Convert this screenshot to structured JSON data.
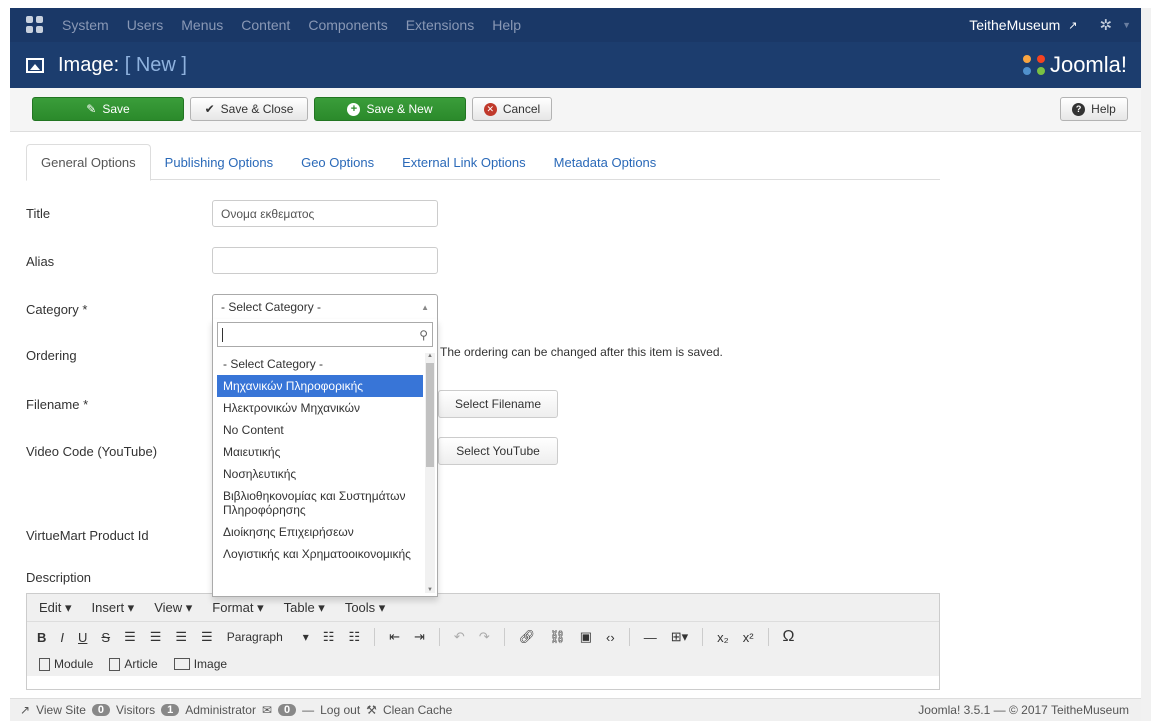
{
  "nav": {
    "menu": [
      "System",
      "Users",
      "Menus",
      "Content",
      "Components",
      "Extensions",
      "Help"
    ],
    "site_name": "TeitheMuseum"
  },
  "title": {
    "main": "Image:",
    "sub": "[ New ]",
    "brand": "Joomla!"
  },
  "toolbar": {
    "save": "Save",
    "save_close": "Save & Close",
    "save_new": "Save & New",
    "cancel": "Cancel",
    "help": "Help"
  },
  "tabs": [
    "General Options",
    "Publishing Options",
    "Geo Options",
    "External Link Options",
    "Metadata Options"
  ],
  "form": {
    "title_label": "Title",
    "title_value": "Ονομα εκθεματος",
    "alias_label": "Alias",
    "alias_value": "",
    "category_label": "Category *",
    "category_value": "- Select Category -",
    "ordering_label": "Ordering",
    "ordering_hint": "The ordering can be changed after this item is saved.",
    "filename_label": "Filename *",
    "filename_button": "Select Filename",
    "video_label": "Video Code (YouTube)",
    "video_button": "Select YouTube",
    "virtuemart_label": "VirtueMart Product Id",
    "description_label": "Description"
  },
  "dropdown": {
    "search_value": "",
    "items": [
      "- Select Category -",
      "Μηχανικών Πληροφορικής",
      "Ηλεκτρονικών Μηχανικών",
      "No Content",
      "Μαιευτικής",
      "Νοσηλευτικής",
      "Βιβλιοθηκονομίας και Συστημάτων Πληροφόρησης",
      "Διοίκησης Επιχειρήσεων",
      "Λογιστικής και Χρηματοοικονομικής"
    ],
    "selected_index": 1
  },
  "editor": {
    "menu": [
      "Edit ▾",
      "Insert ▾",
      "View ▾",
      "Format ▾",
      "Table ▾",
      "Tools ▾"
    ],
    "paragraph": "Paragraph",
    "insert_buttons": [
      "Module",
      "Article",
      "Image"
    ]
  },
  "status": {
    "view_site": "View Site",
    "visitors_count": "0",
    "visitors": "Visitors",
    "admin_count": "1",
    "administrator": "Administrator",
    "messages_count": "0",
    "logout": "Log out",
    "clean_cache": "Clean Cache",
    "version": "Joomla! 3.5.1 — © 2017 TeitheMuseum"
  },
  "colors": {
    "nav_bg": "#1a3867",
    "title_bg": "#1c3d6e",
    "save_green": "#2b8a2b",
    "link_blue": "#2a69b8",
    "selected_blue": "#3875d7"
  }
}
